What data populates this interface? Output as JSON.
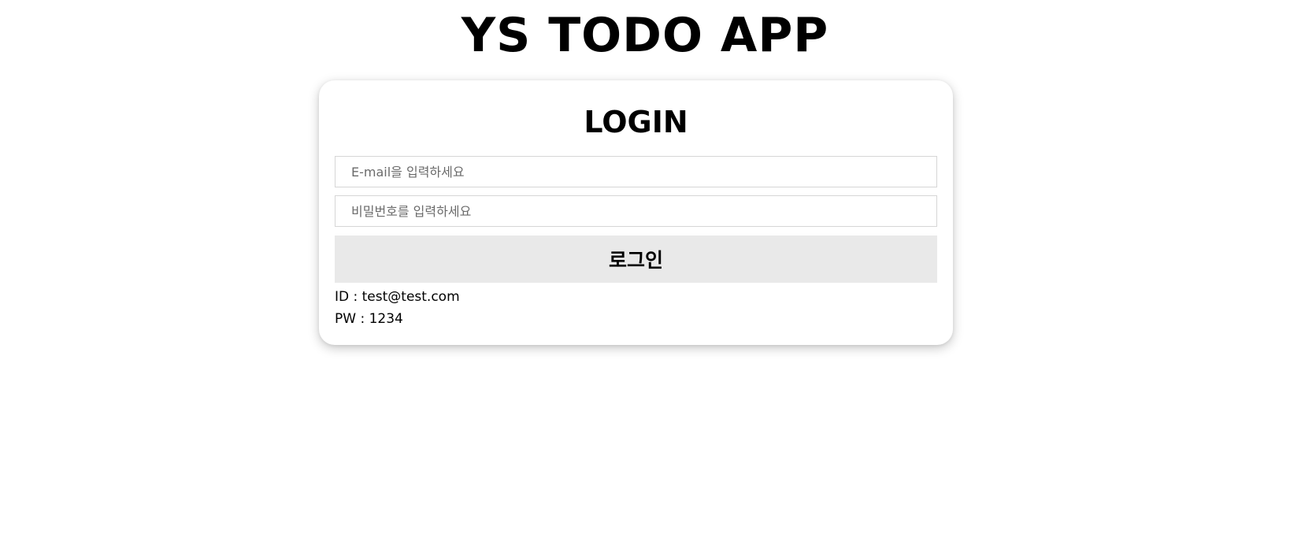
{
  "app": {
    "title": "YS TODO APP"
  },
  "login": {
    "title": "LOGIN",
    "email_placeholder": "E-mail을 입력하세요",
    "email_value": "",
    "password_placeholder": "비밀번호를 입력하세요",
    "password_value": "",
    "submit_label": "로그인",
    "hint_id": "ID : test@test.com",
    "hint_pw": "PW : 1234"
  },
  "colors": {
    "background": "#ffffff",
    "button_background": "#e9e9e9",
    "input_border": "#d6d6d6",
    "text": "#000000"
  }
}
